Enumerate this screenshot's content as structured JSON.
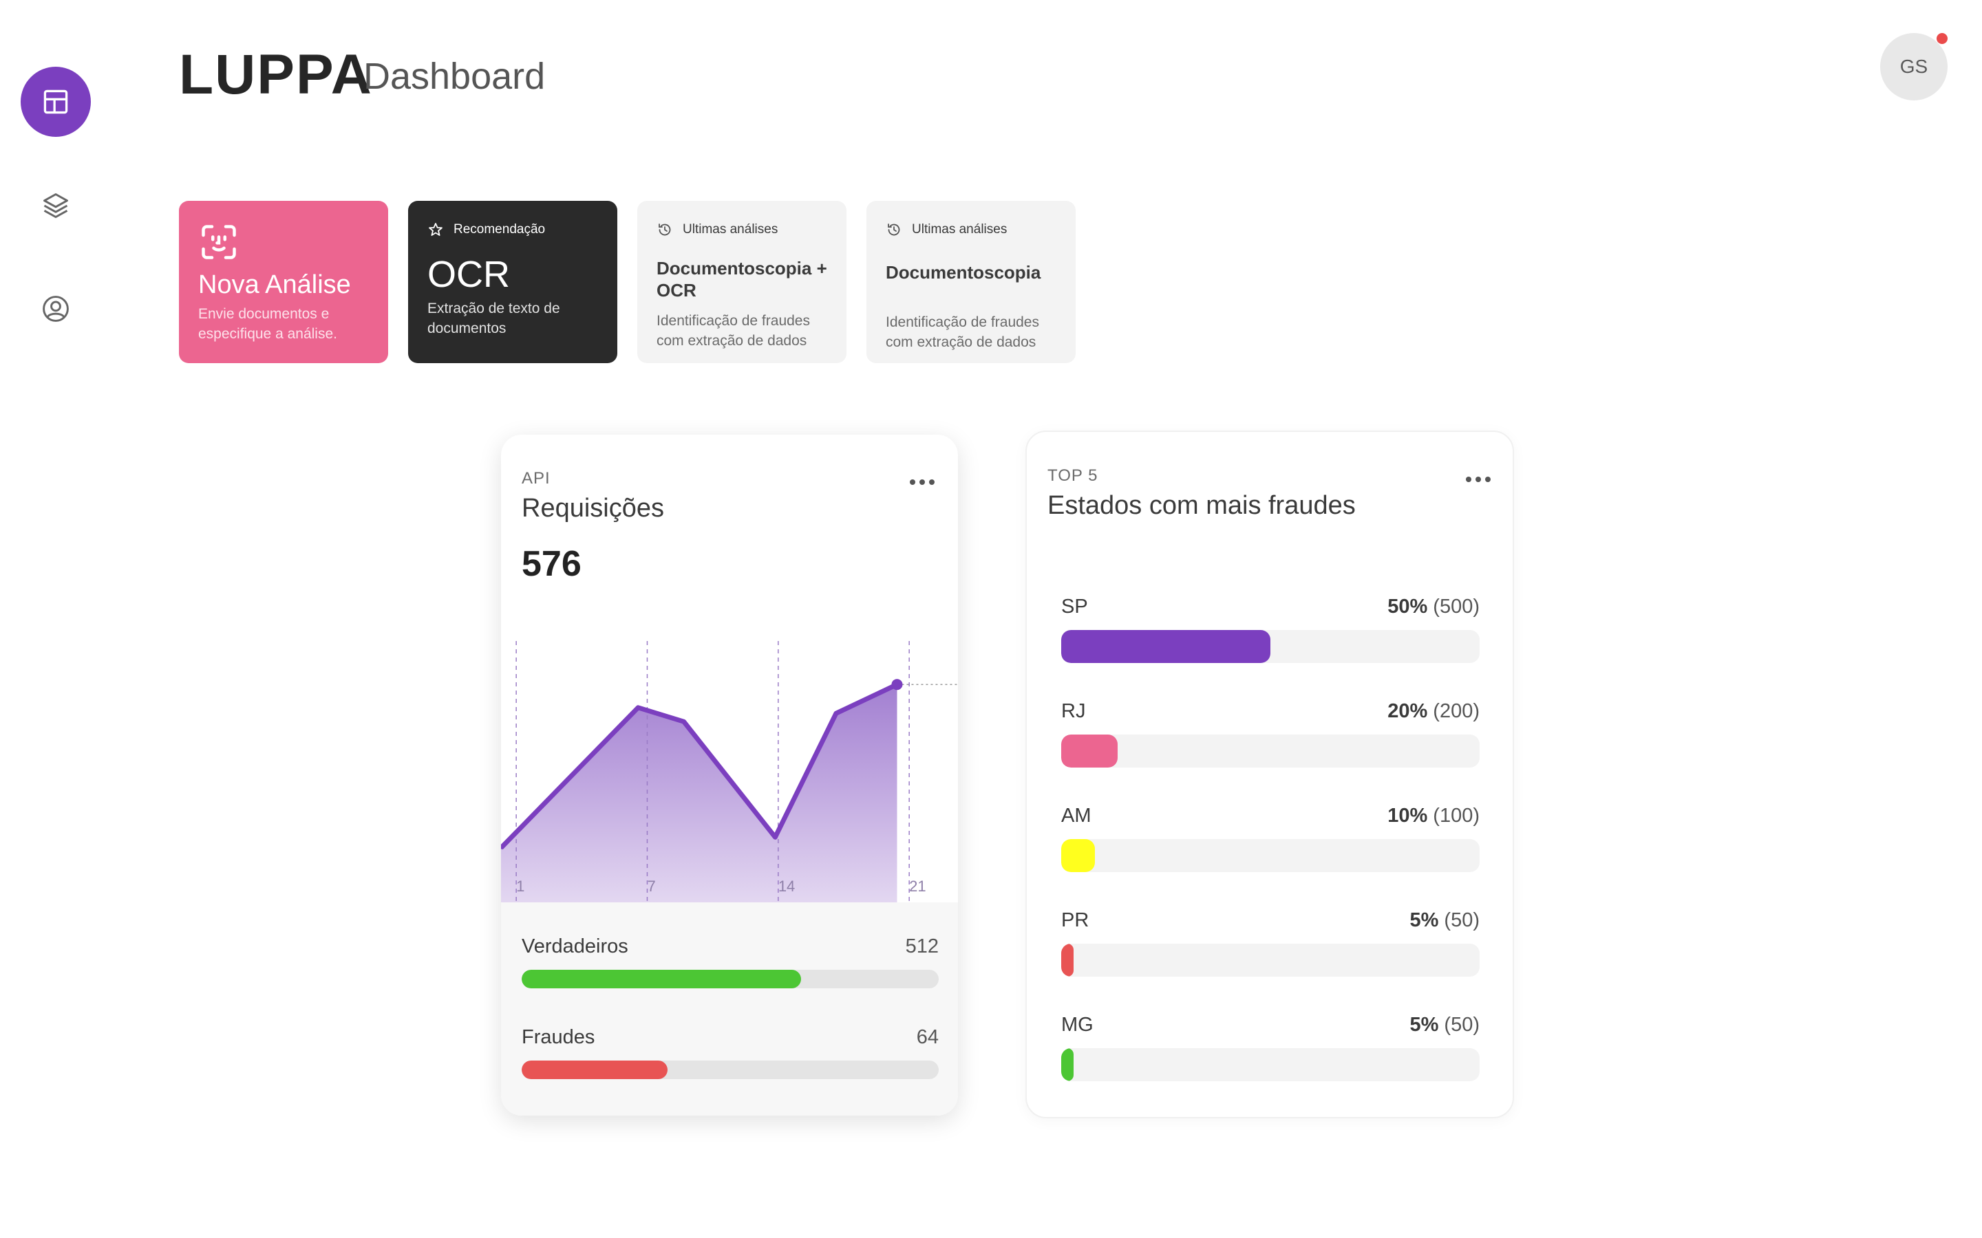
{
  "app": {
    "brand": "LUPPA",
    "page_title": "Dashboard"
  },
  "user": {
    "initials": "GS",
    "has_notification": true
  },
  "sidebar": {
    "items": [
      {
        "icon": "dashboard-icon",
        "active": true
      },
      {
        "icon": "layers-icon",
        "active": false
      },
      {
        "icon": "user-circle-icon",
        "active": false
      }
    ]
  },
  "quick_cards": {
    "new_analysis": {
      "icon": "face-scan-icon",
      "title": "Nova Análise",
      "description": "Envie documentos e especifique a análise."
    },
    "recommendation": {
      "icon": "star-icon",
      "tag": "Recomendação",
      "title": "OCR",
      "description": "Extração de texto de documentos"
    },
    "recent_1": {
      "icon": "history-icon",
      "tag": "Ultimas análises",
      "title": "Documentoscopia + OCR",
      "description": "Identificação de fraudes com extração de dados"
    },
    "recent_2": {
      "icon": "history-icon",
      "tag": "Ultimas análises",
      "title": "Documentoscopia",
      "description": "Identificação de fraudes com extração de dados"
    }
  },
  "api_card": {
    "kicker": "API",
    "title": "Requisições",
    "total": "576",
    "chart_data": {
      "type": "area",
      "x": [
        0,
        9,
        12,
        18,
        22,
        26
      ],
      "values": [
        132,
        472,
        438,
        158,
        458,
        528
      ],
      "x_ticks": [
        "1",
        "7",
        "14",
        "21"
      ],
      "ylim": [
        0,
        700
      ],
      "color": "#7b3fbf"
    },
    "metrics": [
      {
        "label": "Verdadeiros",
        "value": "512",
        "fraction": 0.67,
        "color": "#4cc634"
      },
      {
        "label": "Fraudes",
        "value": "64",
        "fraction": 0.35,
        "color": "#e85454"
      }
    ]
  },
  "top_states_card": {
    "kicker": "TOP 5",
    "title": "Estados com mais fraudes",
    "states": [
      {
        "name": "SP",
        "percent": "50%",
        "count": "(500)",
        "fraction": 0.5,
        "color": "#7b3fbf"
      },
      {
        "name": "RJ",
        "percent": "20%",
        "count": "(200)",
        "fraction": 0.135,
        "color": "#ec6590"
      },
      {
        "name": "AM",
        "percent": "10%",
        "count": "(100)",
        "fraction": 0.08,
        "color": "#ffff1e"
      },
      {
        "name": "PR",
        "percent": "5%",
        "count": "(50)",
        "fraction": 0.03,
        "color": "#e85454"
      },
      {
        "name": "MG",
        "percent": "5%",
        "count": "(50)",
        "fraction": 0.03,
        "color": "#4cc634"
      }
    ]
  }
}
